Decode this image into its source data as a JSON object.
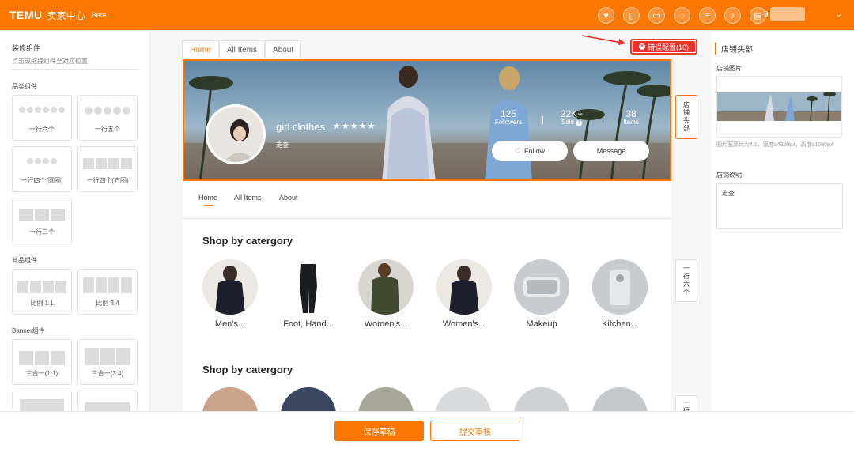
{
  "app": {
    "logo": "TEMU",
    "title": "卖家中心",
    "badge": "Beta",
    "user_initial": "9",
    "colors": {
      "brand": "#fb7701",
      "error": "#e6322a"
    },
    "header_icons": [
      "heart-hands-icon",
      "tablet-icon",
      "book-icon",
      "chat-icon",
      "clipboard-icon",
      "bell-icon",
      "store-icon"
    ]
  },
  "left_panel": {
    "title": "装修组件",
    "subtitle": "点击或拖拽组件至对应位置",
    "sections": [
      {
        "label": "品类组件",
        "items": [
          "一行六个",
          "一行五个",
          "一行四个(圆圈)",
          "一行四个(方图)",
          "一行三个"
        ]
      },
      {
        "label": "商品组件",
        "items": [
          "比例 1:1",
          "比例 3:4"
        ]
      },
      {
        "label": "Banner组件",
        "items": [
          "三合一(1:1)",
          "三合一(3:4)"
        ]
      }
    ]
  },
  "canvas": {
    "tabs": [
      "Home",
      "All Items",
      "About"
    ],
    "error_button": "错误配置(10)",
    "shop": {
      "name": "girl clothes",
      "stars": "★★★★★",
      "subtitle": "走查",
      "stats": [
        {
          "value": "125",
          "label": "Followers"
        },
        {
          "value": "22K+",
          "label": "Sold"
        },
        {
          "value": "38",
          "label": "Items"
        }
      ],
      "follow_label": "Follow",
      "message_label": "Message"
    },
    "inner_tabs": [
      "Home",
      "All Items",
      "About"
    ],
    "sections": [
      {
        "title": "Shop by catergory",
        "items": [
          "Men's...",
          "Foot, Hand...",
          "Women's...",
          "Women's...",
          "Makeup",
          "Kitchen..."
        ]
      },
      {
        "title": "Shop by catergory"
      }
    ],
    "side_tabs": [
      "店铺头部",
      "一行六个",
      "一行"
    ]
  },
  "right_panel": {
    "title": "店铺头部",
    "image_label": "店铺图片",
    "image_hint": "图片宽高比为4:1，宽度≥4320px，高度≥1080px",
    "desc_label": "店铺说明",
    "desc_value": "走查"
  },
  "bottom_bar": {
    "save_label": "保存草稿",
    "submit_label": "提交审核"
  }
}
